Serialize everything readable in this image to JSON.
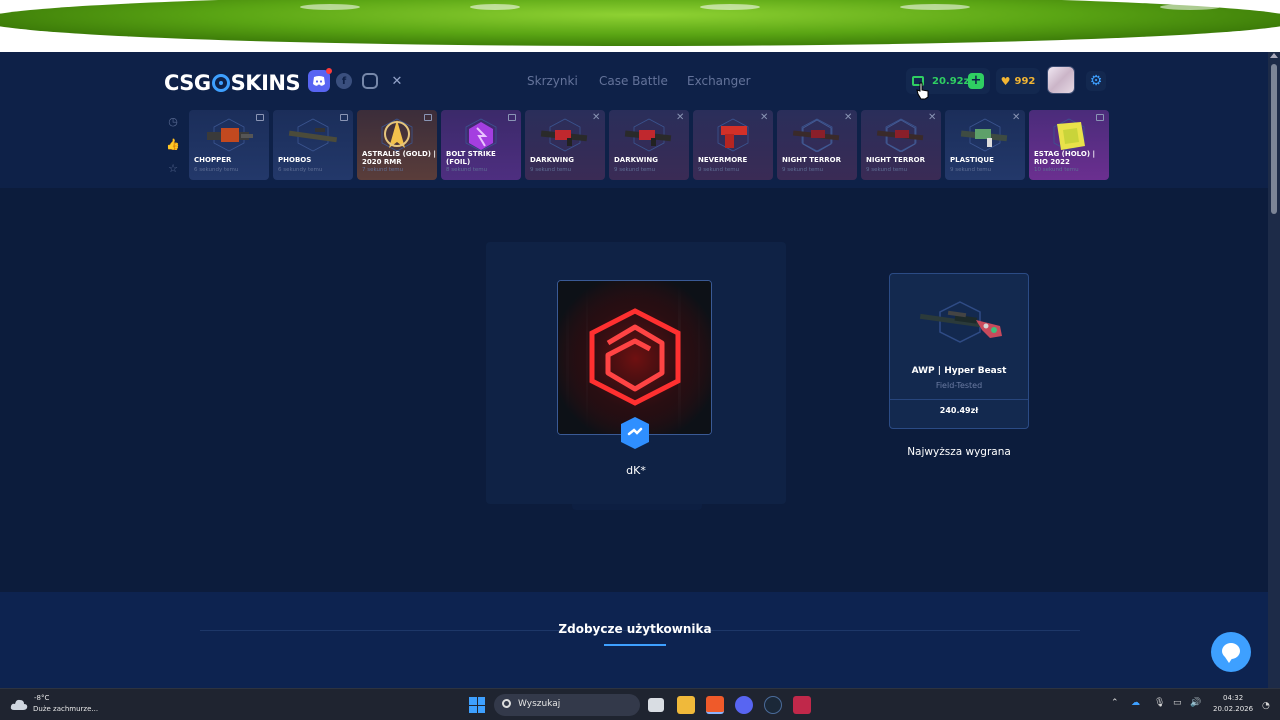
{
  "header": {
    "logo_left": "CSG",
    "logo_right": "SKINS",
    "nav": [
      "Skrzynki",
      "Case Battle",
      "Exchanger"
    ],
    "balance": "20.92zł",
    "coins": "992"
  },
  "live_drops": [
    {
      "name": "CHOPPER",
      "time": "6 sekundy temu",
      "style": "blue",
      "kind": "gun-heavy"
    },
    {
      "name": "PHOBOS",
      "time": "6 sekundy temu",
      "style": "blue",
      "kind": "rifle"
    },
    {
      "name": "ASTRALIS (GOLD) | 2020 RMR",
      "time": "7 sekund temu",
      "style": "gold",
      "kind": "sticker-gold"
    },
    {
      "name": "BOLT STRIKE (FOIL)",
      "time": "8 sekund temu",
      "style": "purple",
      "kind": "sticker-purple"
    },
    {
      "name": "DARKWING",
      "time": "9 sekund temu",
      "style": "red",
      "kind": "rifle-red"
    },
    {
      "name": "DARKWING",
      "time": "9 sekund temu",
      "style": "red",
      "kind": "rifle-red"
    },
    {
      "name": "NEVERMORE",
      "time": "9 sekund temu",
      "style": "red",
      "kind": "pistol-red"
    },
    {
      "name": "NIGHT TERROR",
      "time": "9 sekund temu",
      "style": "red",
      "kind": "rifle-dark"
    },
    {
      "name": "NIGHT TERROR",
      "time": "9 sekund temu",
      "style": "red",
      "kind": "rifle-dark"
    },
    {
      "name": "PLASTIQUE",
      "time": "9 sekund temu",
      "style": "blue",
      "kind": "rifle-green"
    },
    {
      "name": "ESTAG (HOLO) | RIO 2022",
      "time": "10 sekund temu",
      "style": "violet",
      "kind": "sticker-yellow"
    }
  ],
  "case": {
    "creator": "dK*"
  },
  "best_drop": {
    "skin": "AWP | Hyper Beast",
    "wear": "Field-Tested",
    "price": "240.49zł",
    "label": "Najwyższa wygrana"
  },
  "section": {
    "title": "Zdobycze użytkownika"
  },
  "taskbar": {
    "temp": "-8°C",
    "weather": "Duże zachmurze...",
    "search": "Wyszukaj",
    "time": "04:32",
    "date": "20.02.2026"
  },
  "colors": {
    "background": "#0c1c3c",
    "accent": "#3ea0ff",
    "balance": "#2fcf62",
    "coins": "#f2b533"
  }
}
